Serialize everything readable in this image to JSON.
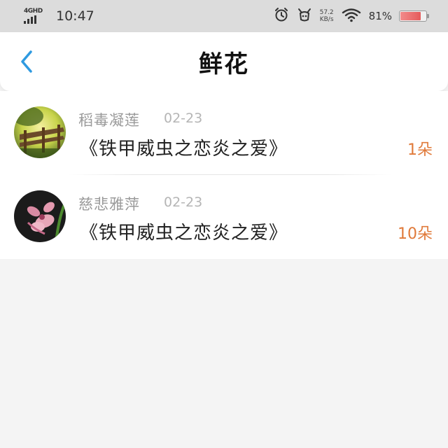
{
  "status_bar": {
    "network": "4G",
    "hd": "HD",
    "time": "10:47",
    "speed_value": "57.2",
    "speed_unit": "KB/s",
    "battery_percent": "81%",
    "battery_level": 0.81,
    "icons": [
      "signal-icon",
      "alarm-icon",
      "notification-icon",
      "wifi-icon",
      "battery-icon"
    ]
  },
  "header": {
    "title": "鲜花",
    "back_icon": "chevron-left-icon",
    "accent_color": "#2f9ae0"
  },
  "records": [
    {
      "name": "稻毒凝莲",
      "date": "02-23",
      "gift_text": "《铁甲威虫之恋炎之爱》",
      "count": "1朵",
      "avatar": "garden-fence-photo"
    },
    {
      "name": "慈悲雅萍",
      "date": "02-23",
      "gift_text": "《铁甲威虫之恋炎之爱》",
      "count": "10朵",
      "avatar": "pink-orchid-photo"
    }
  ],
  "colors": {
    "count": "#e07a3a",
    "name": "#9a9a9a",
    "date": "#b5b5b5"
  }
}
